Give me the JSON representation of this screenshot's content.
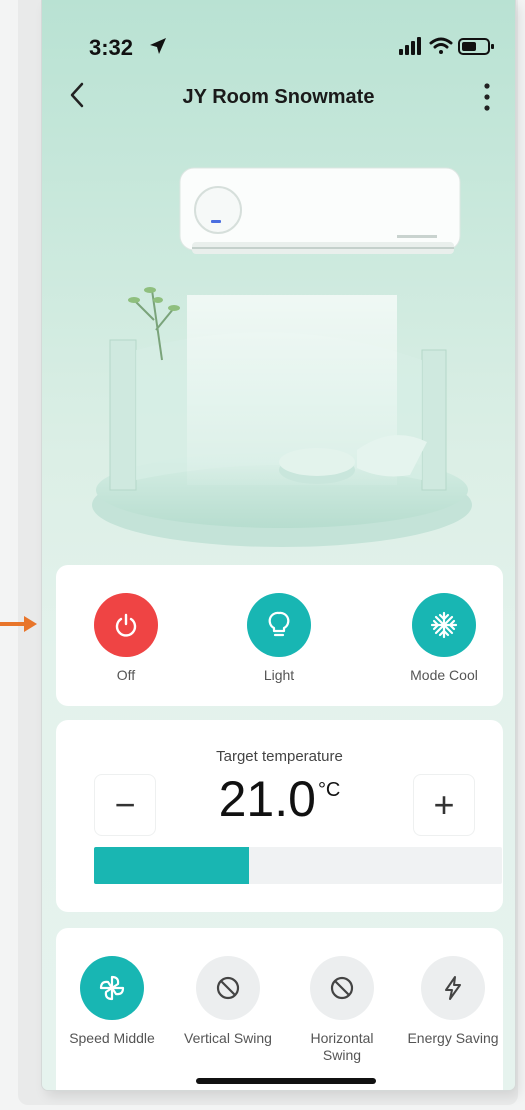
{
  "status_bar": {
    "time": "3:32"
  },
  "nav": {
    "title": "JY Room Snowmate"
  },
  "controls": {
    "power": {
      "label": "Off",
      "icon": "power-icon",
      "color": "#ef4444"
    },
    "light": {
      "label": "Light",
      "icon": "lightbulb-icon",
      "color": "#18b6b3"
    },
    "mode": {
      "label": "Mode Cool",
      "icon": "snowflake-icon",
      "color": "#18b6b3"
    }
  },
  "temperature": {
    "label": "Target temperature",
    "value": "21.0",
    "unit": "°C",
    "minus": "−",
    "plus": "+",
    "level_fraction": 0.38,
    "accent": "#19b6b2"
  },
  "functions": [
    {
      "label": "Speed Middle",
      "icon": "fan-icon",
      "active": true
    },
    {
      "label": "Vertical Swing",
      "icon": "disabled-icon",
      "active": false
    },
    {
      "label": "Horizontal Swing",
      "icon": "disabled-icon",
      "active": false
    },
    {
      "label": "Energy Saving",
      "icon": "lightning-icon",
      "active": false
    }
  ]
}
